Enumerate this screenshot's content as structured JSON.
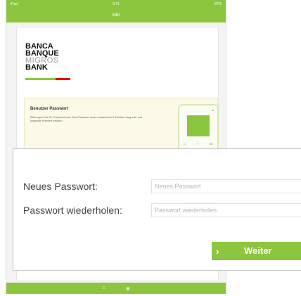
{
  "statusbar": {
    "left": "iPad",
    "center": "9:41",
    "right": "87%"
  },
  "navbar": {
    "title": "MBI"
  },
  "logo": {
    "line1": "BANCA",
    "line2": "BANQUE",
    "line3": "MIGROS",
    "line4": "BANK"
  },
  "card": {
    "title": "Benutzer Passwort",
    "text": "Bitte legen Sie Ihr Passwort fest. Das Passwort muss mindestens 8 Zeichen lang sein und folgende Kriterien erfüllen.",
    "field_label": "Neues Passwort"
  },
  "device": {
    "keys": [
      "C",
      "?",
      "OK"
    ],
    "dot": "●"
  },
  "form": {
    "new_password": {
      "label": "Neues Passwort:",
      "placeholder": "Neues Passwort"
    },
    "repeat_password": {
      "label": "Passwort wiederholen:",
      "placeholder": "Passwort wiederholen"
    },
    "next_button": {
      "label": "Weiter",
      "chevron": "›"
    }
  },
  "bottombar": {
    "items": [
      "≡",
      "◼"
    ]
  },
  "colors": {
    "accent": "#8cc63f",
    "logo_red": "#e30613"
  }
}
